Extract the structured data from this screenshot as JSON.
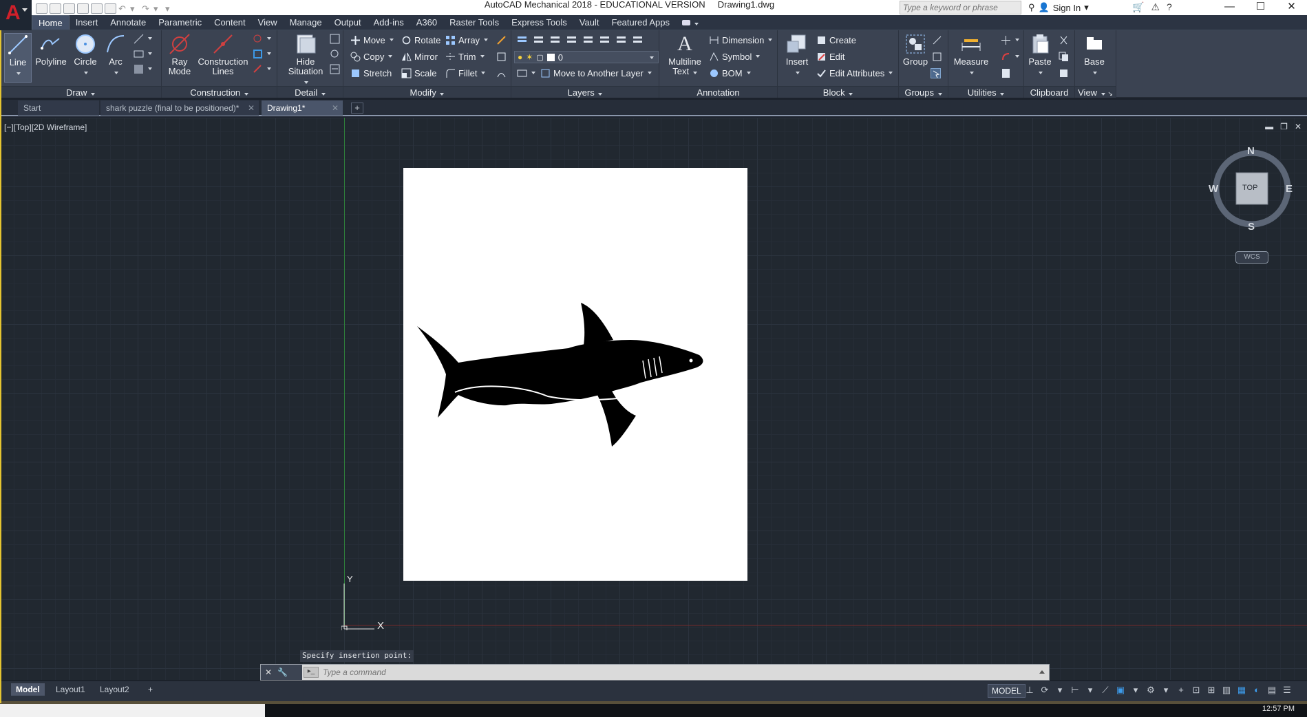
{
  "window": {
    "app_title": "AutoCAD Mechanical 2018 - EDUCATIONAL VERSION",
    "doc_title": "Drawing1.dwg",
    "search_placeholder": "Type a keyword or phrase",
    "sign_in": "Sign In"
  },
  "ribbon_tabs": [
    "Home",
    "Insert",
    "Annotate",
    "Parametric",
    "Content",
    "View",
    "Manage",
    "Output",
    "Add-ins",
    "A360",
    "Raster Tools",
    "Express Tools",
    "Vault",
    "Featured Apps"
  ],
  "panels": {
    "draw": {
      "title": "Draw",
      "line": "Line",
      "polyline": "Polyline",
      "circle": "Circle",
      "arc": "Arc"
    },
    "construction": {
      "title": "Construction",
      "ray_mode_1": "Ray",
      "ray_mode_2": "Mode",
      "construction_lines_1": "Construction",
      "construction_lines_2": "Lines"
    },
    "detail": {
      "title": "Detail",
      "hide_1": "Hide",
      "hide_2": "Situation"
    },
    "modify": {
      "title": "Modify",
      "move": "Move",
      "rotate": "Rotate",
      "array": "Array",
      "copy": "Copy",
      "mirror": "Mirror",
      "trim": "Trim",
      "stretch": "Stretch",
      "scale": "Scale",
      "fillet": "Fillet"
    },
    "layers": {
      "title": "Layers",
      "current_layer": "0",
      "move_to_layer": "Move to Another Layer"
    },
    "annotation": {
      "title": "Annotation",
      "multiline_1": "Multiline",
      "multiline_2": "Text",
      "dimension": "Dimension",
      "symbol": "Symbol",
      "bom": "BOM"
    },
    "block": {
      "title": "Block",
      "insert": "Insert",
      "create": "Create",
      "edit": "Edit",
      "edit_attributes": "Edit Attributes"
    },
    "groups": {
      "title": "Groups",
      "group": "Group"
    },
    "utilities": {
      "title": "Utilities",
      "measure": "Measure"
    },
    "clipboard": {
      "title": "Clipboard",
      "paste": "Paste"
    },
    "view": {
      "title": "View",
      "base": "Base"
    }
  },
  "file_tabs": {
    "start": "Start",
    "shark": "shark puzzle (final to be positioned)*",
    "drawing1": "Drawing1*"
  },
  "viewport": {
    "label": "[−][Top][2D Wireframe]",
    "compass": {
      "n": "N",
      "s": "S",
      "e": "E",
      "w": "W",
      "face": "TOP"
    },
    "wcs": "WCS",
    "ucs_x": "X",
    "ucs_y": "Y",
    "prompt": "Specify insertion point:"
  },
  "command_line": {
    "placeholder": "Type a command"
  },
  "layout_tabs": [
    "Model",
    "Layout1",
    "Layout2"
  ],
  "status": {
    "model": "MODEL",
    "clock": "12:57 PM"
  },
  "colors": {
    "accent": "#d0202a",
    "ribbon": "#3b4352",
    "canvas": "#212830",
    "highlight": "#3d9ae8"
  }
}
